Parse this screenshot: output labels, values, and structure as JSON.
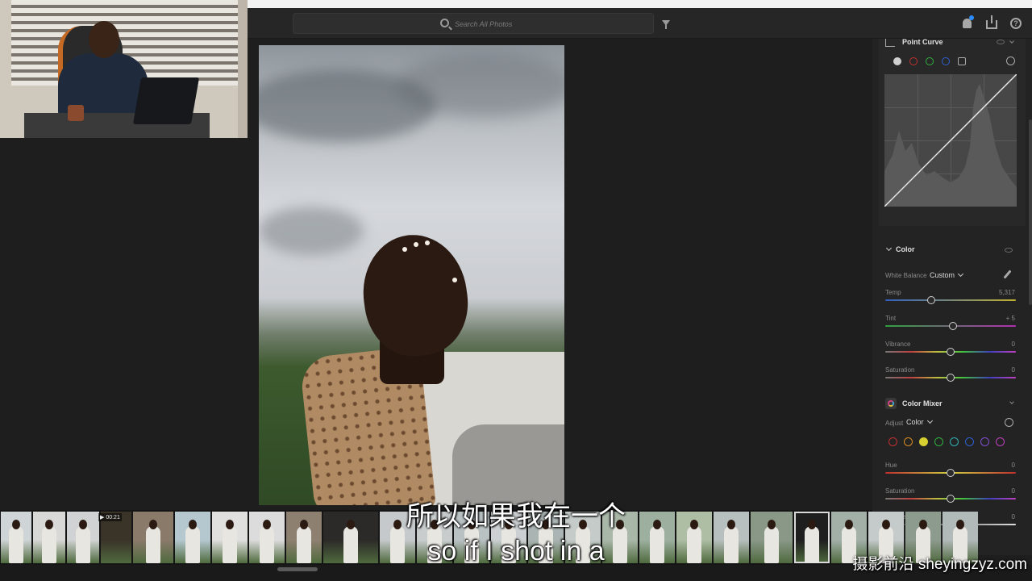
{
  "topbar": {
    "search_placeholder": "Search All Photos",
    "icons": [
      "search-icon",
      "filter-icon",
      "bell-icon",
      "share-icon",
      "help-icon"
    ]
  },
  "panel": {
    "point_curve": {
      "title": "Point Curve",
      "channels": [
        {
          "name": "rgb",
          "color": "#d0d0d0"
        },
        {
          "name": "red",
          "color": "#c03030"
        },
        {
          "name": "green",
          "color": "#30b040"
        },
        {
          "name": "blue",
          "color": "#3060d0"
        }
      ]
    },
    "color": {
      "title": "Color",
      "white_balance_label": "White Balance",
      "white_balance_value": "Custom",
      "sliders": [
        {
          "label": "Temp",
          "value": "5,317",
          "position": 0.35
        },
        {
          "label": "Tint",
          "value": "+ 5",
          "position": 0.52
        },
        {
          "label": "Vibrance",
          "value": "0",
          "position": 0.5
        },
        {
          "label": "Saturation",
          "value": "0",
          "position": 0.5
        }
      ]
    },
    "color_mixer": {
      "title": "Color Mixer",
      "adjust_label": "Adjust",
      "adjust_value": "Color",
      "swatches": [
        "#c03030",
        "#d88a20",
        "#d8d030",
        "#30b040",
        "#30b0b0",
        "#3060d0",
        "#8050d0",
        "#c040c0"
      ],
      "sliders": [
        {
          "label": "Hue",
          "value": "0",
          "position": 0.5
        },
        {
          "label": "Saturation",
          "value": "0",
          "position": 0.5
        },
        {
          "label": "Luminance",
          "value": "0",
          "position": 0.5
        }
      ]
    }
  },
  "filmstrip": {
    "video_badge": "▶ 00:21"
  },
  "captions": {
    "line1": "所以如果我在一个",
    "line2": "so if I shot in a",
    "watermark": "摄影前沿 sheyingzyz.com"
  }
}
